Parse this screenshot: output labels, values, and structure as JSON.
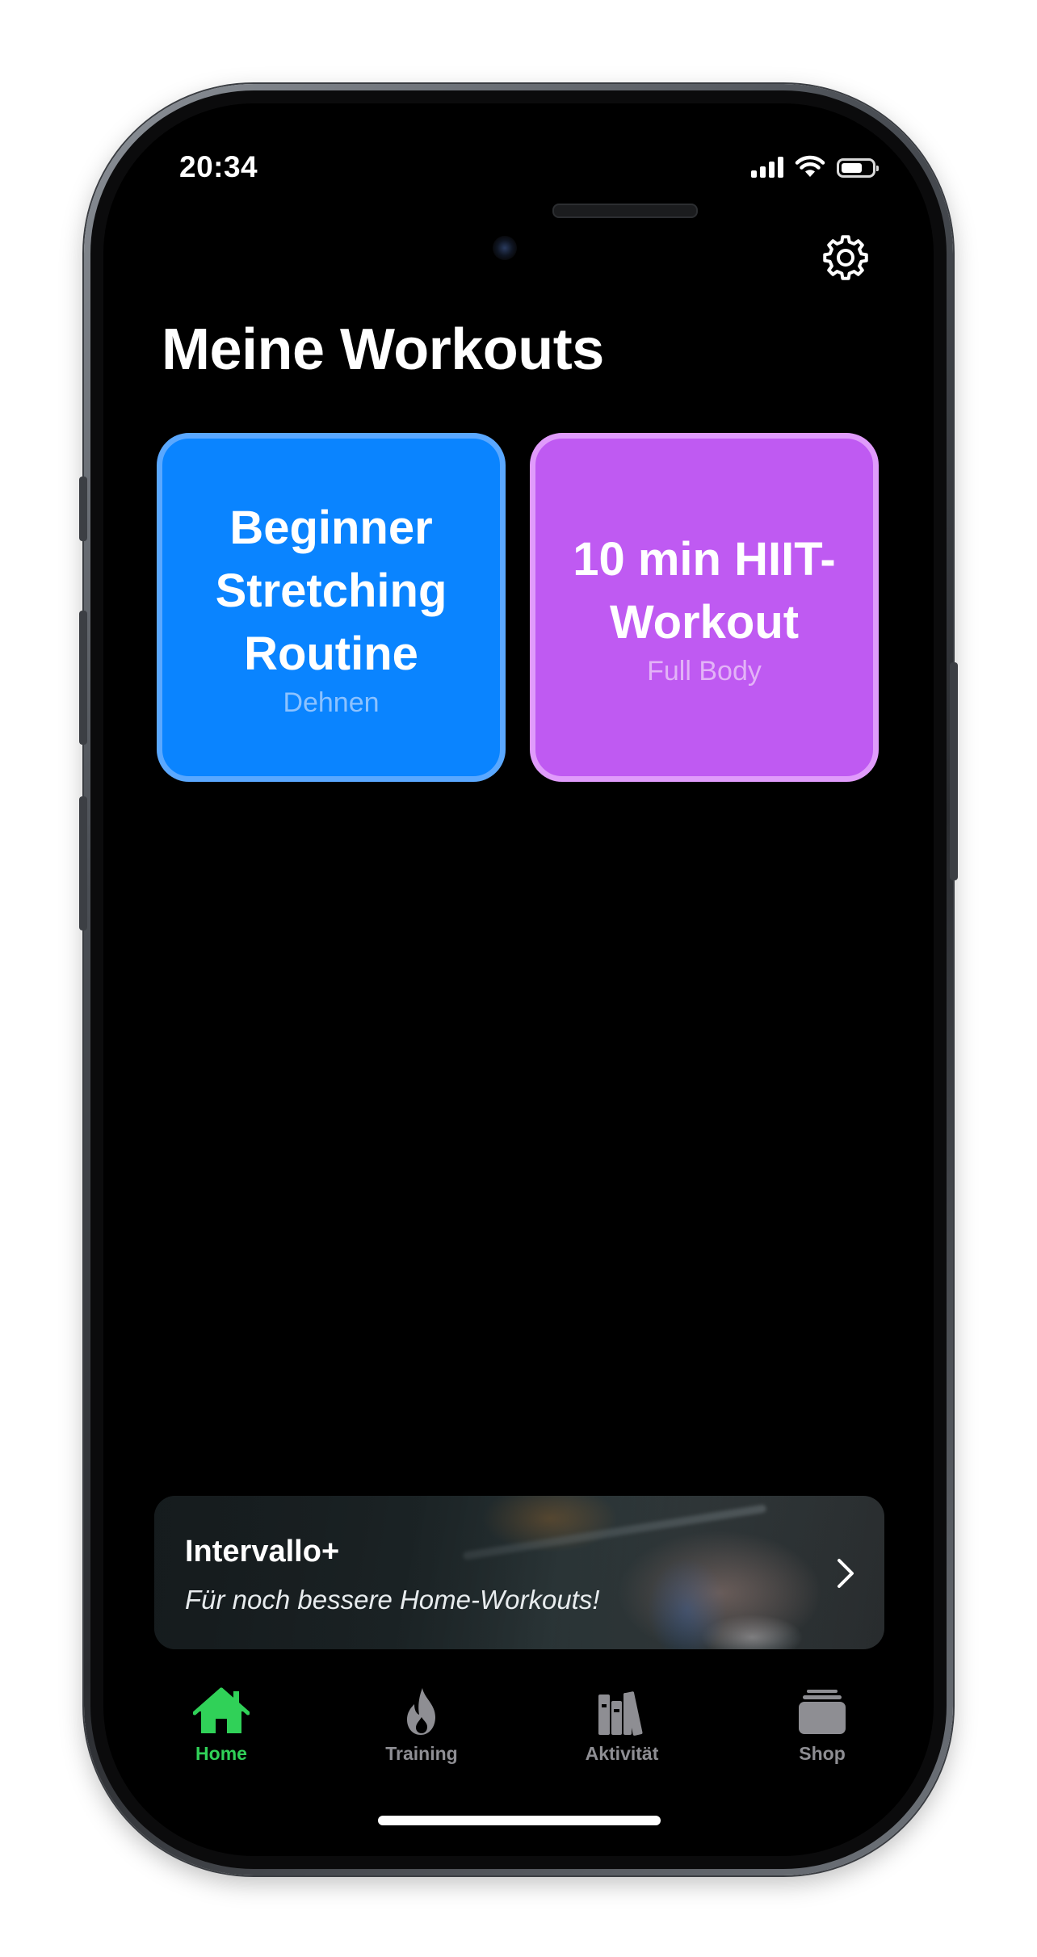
{
  "status_bar": {
    "time": "20:34",
    "battery_level": 0.7
  },
  "header": {
    "title": "Meine Workouts",
    "settings_icon": "gear-icon"
  },
  "workouts": [
    {
      "title": "Beginner Stretching Routine",
      "category": "Dehnen",
      "color": "#0a84ff"
    },
    {
      "title": "10 min HIIT-Workout",
      "category": "Full Body",
      "color": "#bf5af2"
    }
  ],
  "promo": {
    "title": "Intervallo+",
    "subtitle": "Für noch bessere Home-Workouts!",
    "icon": "chevron-right-icon"
  },
  "tab_bar": {
    "items": [
      {
        "label": "Home",
        "icon": "house-icon",
        "active": true
      },
      {
        "label": "Training",
        "icon": "flame-icon",
        "active": false
      },
      {
        "label": "Aktivität",
        "icon": "books-icon",
        "active": false
      },
      {
        "label": "Shop",
        "icon": "stack-icon",
        "active": false
      }
    ],
    "active_color": "#30d158",
    "inactive_color": "#8e8e93"
  }
}
